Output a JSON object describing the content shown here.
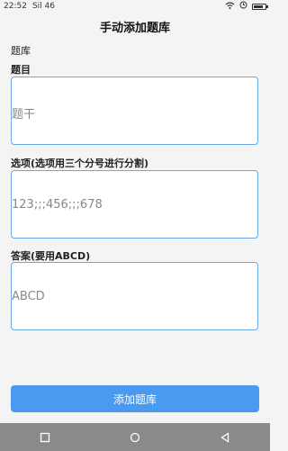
{
  "status_bar": {
    "time": "22:52",
    "signal_text": "Sil 46",
    "battery_level": 0.8
  },
  "header": {
    "title": "手动添加题库"
  },
  "form": {
    "section_label": "题库",
    "question": {
      "label": "题目",
      "placeholder": "题干"
    },
    "options": {
      "label": "选项(选项用三个分号进行分割)",
      "placeholder": "123;;;456;;;678"
    },
    "answer": {
      "label": "答案(要用ABCD)",
      "placeholder": "ABCD"
    },
    "submit_label": "添加题库"
  },
  "system_nav": {
    "buttons": [
      "square-icon",
      "circle-icon",
      "triangle-icon"
    ]
  }
}
